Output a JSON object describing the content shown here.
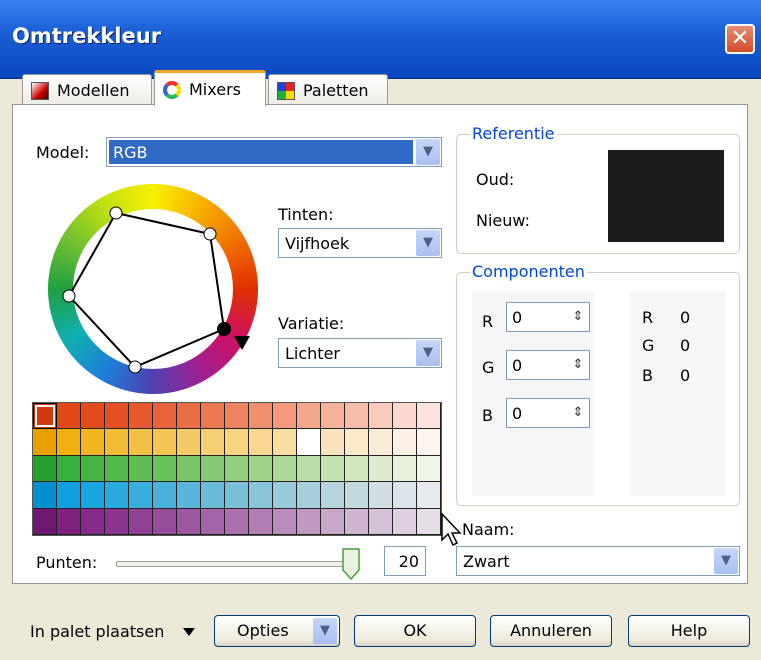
{
  "window": {
    "title": "Omtrekkleur",
    "close_symbol": "✕"
  },
  "tabs": [
    {
      "label": "Modellen",
      "active": false
    },
    {
      "label": "Mixers",
      "active": true
    },
    {
      "label": "Paletten",
      "active": false
    }
  ],
  "model": {
    "label": "Model:",
    "value": "RGB"
  },
  "tinten": {
    "label": "Tinten:",
    "value": "Vijfhoek"
  },
  "variatie": {
    "label": "Variatie:",
    "value": "Lichter"
  },
  "punten": {
    "label": "Punten:",
    "value": "20",
    "slider_level": 1.0
  },
  "referentie": {
    "title": "Referentie",
    "old_label": "Oud:",
    "new_label": "Nieuw:",
    "old_color": "#1c1c1c",
    "new_color": "#1c1c1c"
  },
  "componenten": {
    "title": "Componenten",
    "fields": [
      {
        "label": "R",
        "value": "0"
      },
      {
        "label": "G",
        "value": "0"
      },
      {
        "label": "B",
        "value": "0"
      }
    ],
    "readout": [
      {
        "label": "R",
        "value": "0"
      },
      {
        "label": "G",
        "value": "0"
      },
      {
        "label": "B",
        "value": "0"
      }
    ]
  },
  "naam": {
    "label": "Naam:",
    "value": "Zwart"
  },
  "buttons": {
    "place_in_palette": "In palet plaatsen",
    "opties": "Opties",
    "ok": "OK",
    "annuleren": "Annuleren",
    "help": "Help"
  },
  "palette_rows": [
    [
      "#d03810",
      "#e04818",
      "#e34b1d",
      "#e55124",
      "#e6592e",
      "#e86339",
      "#ea6d45",
      "#ec7852",
      "#ee835f",
      "#f08f6d",
      "#f29a7b",
      "#f3a68a",
      "#f5b29a",
      "#f7beab",
      "#f9cbbd",
      "#fbd8cf",
      "#fce3dd"
    ],
    [
      "#e8a000",
      "#f0b010",
      "#f2b623",
      "#f3bb34",
      "#f3c045",
      "#f4c555",
      "#f5ca64",
      "#f6ce73",
      "#f7d382",
      "#f8d791",
      "#f9dca0",
      "#faе0ae",
      "#fbe4bd",
      "#fbe9cb",
      "#fcedd9",
      "#fdf1e5",
      "#fef5ee"
    ],
    [
      "#28a030",
      "#38b040",
      "#48b543",
      "#53b94a",
      "#5fbd53",
      "#6bc15d",
      "#78c567",
      "#85ca72",
      "#92ce7e",
      "#9fd38a",
      "#acd897",
      "#b9dda4",
      "#c5e2b2",
      "#d1e7bf",
      "#dcebcd",
      "#e6f0db",
      "#eff5e8"
    ],
    [
      "#0090d0",
      "#10a0e0",
      "#1ba5e0",
      "#2aaade",
      "#3aaedb",
      "#4ab2da",
      "#5ab6d9",
      "#6abbd8",
      "#7ac0d8",
      "#89c5d8",
      "#98cad9",
      "#a7cfdb",
      "#b5d4dd",
      "#c2d9e0",
      "#cfdee3",
      "#dbe4e8",
      "#e6eaee"
    ],
    [
      "#701870",
      "#802080",
      "#85298a",
      "#8a348f",
      "#914095",
      "#974c9b",
      "#9d58a1",
      "#a465a8",
      "#ab72ae",
      "#b27fb5",
      "#b98cbc",
      "#c099c3",
      "#c7a7ca",
      "#cfb4d1",
      "#d6c1d8",
      "#decfe0",
      "#e6dde8"
    ]
  ]
}
